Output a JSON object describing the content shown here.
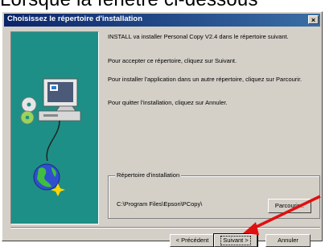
{
  "caption": "Lorsque la fenêtre ci-dessous",
  "window": {
    "title": "Choisissez le répertoire d'installation",
    "close_glyph": "×"
  },
  "body": {
    "paragraph1": "INSTALL va installer Personal Copy V2.4 dans le répertoire suivant.",
    "paragraph2": "Pour accepter ce répertoire, cliquez sur Suivant.",
    "paragraph3": "Pour installer l'application dans un autre répertoire, cliquez sur Parcourir.",
    "paragraph4": "Pour quitter l'installation, cliquez sur Annuler."
  },
  "destination": {
    "label": "Répertoire d'installation",
    "path": "C:\\Program Files\\Epson\\PCopy\\",
    "browse_label": "Parcourir..."
  },
  "buttons": {
    "prev": "< Précédent",
    "next": "Suivant >",
    "cancel": "Annuler"
  },
  "icons": {
    "illustration": "computer-cd-globe-icon",
    "annotation": "red-arrow-icon"
  },
  "colors": {
    "titlebar_start": "#0a246a",
    "illustration_bg": "#1e8f86",
    "arrow": "#e01010"
  }
}
